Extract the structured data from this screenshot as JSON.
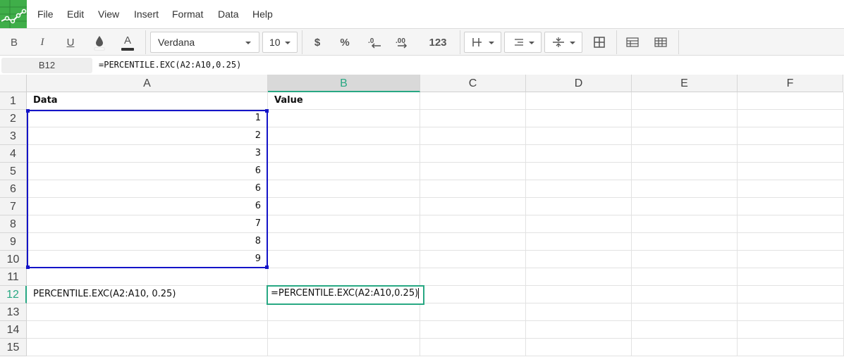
{
  "menu": [
    "File",
    "Edit",
    "View",
    "Insert",
    "Format",
    "Data",
    "Help"
  ],
  "toolbar": {
    "bold": "B",
    "italic": "I",
    "underline": "U",
    "text_color": "A",
    "font": "Verdana",
    "size": "10",
    "currency": "$",
    "percent": "%",
    "dec_decrease": ".0",
    "dec_increase": ".00",
    "number_format": "123"
  },
  "namebox": "B12",
  "formula": "=PERCENTILE.EXC(A2:A10,0.25)",
  "columns": [
    "A",
    "B",
    "C",
    "D",
    "E",
    "F"
  ],
  "rows": [
    "1",
    "2",
    "3",
    "4",
    "5",
    "6",
    "7",
    "8",
    "9",
    "10",
    "11",
    "12",
    "13",
    "14",
    "15"
  ],
  "cells": {
    "A1": "Data",
    "B1": "Value",
    "A_values": [
      "1",
      "2",
      "3",
      "6",
      "6",
      "6",
      "7",
      "8",
      "9"
    ],
    "A12": "PERCENTILE.EXC(A2:A10, 0.25)"
  },
  "editor": "=PERCENTILE.EXC(A2:A10,0.25)",
  "colors": {
    "accent": "#28a883",
    "selection": "#1414c8",
    "logo": "#3fae49"
  }
}
